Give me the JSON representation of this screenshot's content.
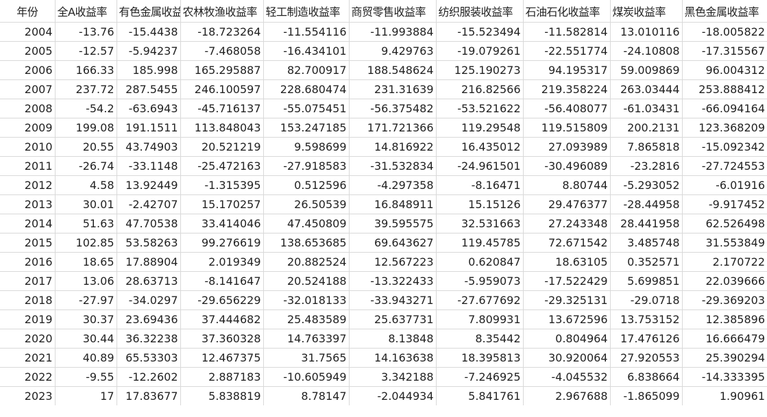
{
  "headers": [
    "年份",
    "全A收益率",
    "有色金属收益率",
    "农林牧渔收益率",
    "轻工制造收益率",
    "商贸零售收益率",
    "纺织服装收益率",
    "石油石化收益率",
    "煤炭收益率",
    "黑色金属收益率"
  ],
  "rows": [
    [
      "2004",
      "-13.76",
      "-15.4438",
      "-18.723264",
      "-11.554116",
      "-11.993884",
      "-15.523494",
      "-11.582814",
      "13.010116",
      "-18.005822"
    ],
    [
      "2005",
      "-12.57",
      "-5.94237",
      "-7.468058",
      "-16.434101",
      "9.429763",
      "-19.079261",
      "-22.551774",
      "-24.10808",
      "-17.315567"
    ],
    [
      "2006",
      "166.33",
      "185.998",
      "165.295887",
      "82.700917",
      "188.548624",
      "125.190273",
      "94.195317",
      "59.009869",
      "96.004312"
    ],
    [
      "2007",
      "237.72",
      "287.5455",
      "246.100597",
      "228.680474",
      "231.31639",
      "216.82566",
      "219.358224",
      "263.03444",
      "253.888412"
    ],
    [
      "2008",
      "-54.2",
      "-63.6943",
      "-45.716137",
      "-55.075451",
      "-56.375482",
      "-53.521622",
      "-56.408077",
      "-61.03431",
      "-66.094164"
    ],
    [
      "2009",
      "199.08",
      "191.1511",
      "113.848043",
      "153.247185",
      "171.721366",
      "119.29548",
      "119.515809",
      "200.2131",
      "123.368209"
    ],
    [
      "2010",
      "20.55",
      "43.74903",
      "20.521219",
      "9.598699",
      "14.816922",
      "16.435012",
      "27.093989",
      "7.865818",
      "-15.092342"
    ],
    [
      "2011",
      "-26.74",
      "-33.1148",
      "-25.472163",
      "-27.918583",
      "-31.532834",
      "-24.961501",
      "-30.496089",
      "-23.2816",
      "-27.724553"
    ],
    [
      "2012",
      "4.58",
      "13.92449",
      "-1.315395",
      "0.512596",
      "-4.297358",
      "-8.16471",
      "8.80744",
      "-5.293052",
      "-6.01916"
    ],
    [
      "2013",
      "30.01",
      "-2.42707",
      "15.170257",
      "26.50539",
      "16.848911",
      "15.15126",
      "29.476377",
      "-28.44958",
      "-9.917452"
    ],
    [
      "2014",
      "51.63",
      "47.70538",
      "33.414046",
      "47.450809",
      "39.595575",
      "32.531663",
      "27.243348",
      "28.441958",
      "62.526498"
    ],
    [
      "2015",
      "102.85",
      "53.58263",
      "99.276619",
      "138.653685",
      "69.643627",
      "119.45785",
      "72.671542",
      "3.485748",
      "31.553849"
    ],
    [
      "2016",
      "18.65",
      "17.88904",
      "2.019349",
      "20.882524",
      "12.567223",
      "0.620847",
      "18.63105",
      "0.352571",
      "2.170722"
    ],
    [
      "2017",
      "13.06",
      "28.63713",
      "-8.141647",
      "20.524188",
      "-13.322433",
      "-5.959073",
      "-17.522429",
      "5.699851",
      "22.039666"
    ],
    [
      "2018",
      "-27.97",
      "-34.0297",
      "-29.656229",
      "-32.018133",
      "-33.943271",
      "-27.677692",
      "-29.325131",
      "-29.0718",
      "-29.369203"
    ],
    [
      "2019",
      "30.37",
      "23.69436",
      "37.444682",
      "25.483589",
      "25.637731",
      "7.809931",
      "13.672596",
      "13.753152",
      "12.385896"
    ],
    [
      "2020",
      "30.44",
      "36.32238",
      "37.360328",
      "14.763397",
      "8.13848",
      "8.35442",
      "0.804964",
      "17.476126",
      "16.666479"
    ],
    [
      "2021",
      "40.89",
      "65.53303",
      "12.467375",
      "31.7565",
      "14.163638",
      "18.395813",
      "30.920064",
      "27.920553",
      "25.390294"
    ],
    [
      "2022",
      "-9.55",
      "-12.2602",
      "2.887183",
      "-10.605949",
      "3.342188",
      "-7.246925",
      "-4.045532",
      "6.838664",
      "-14.333395"
    ],
    [
      "2023",
      "17",
      "17.83677",
      "5.838819",
      "8.78147",
      "-2.044934",
      "5.841761",
      "2.967688",
      "-1.865099",
      "1.90961"
    ]
  ]
}
